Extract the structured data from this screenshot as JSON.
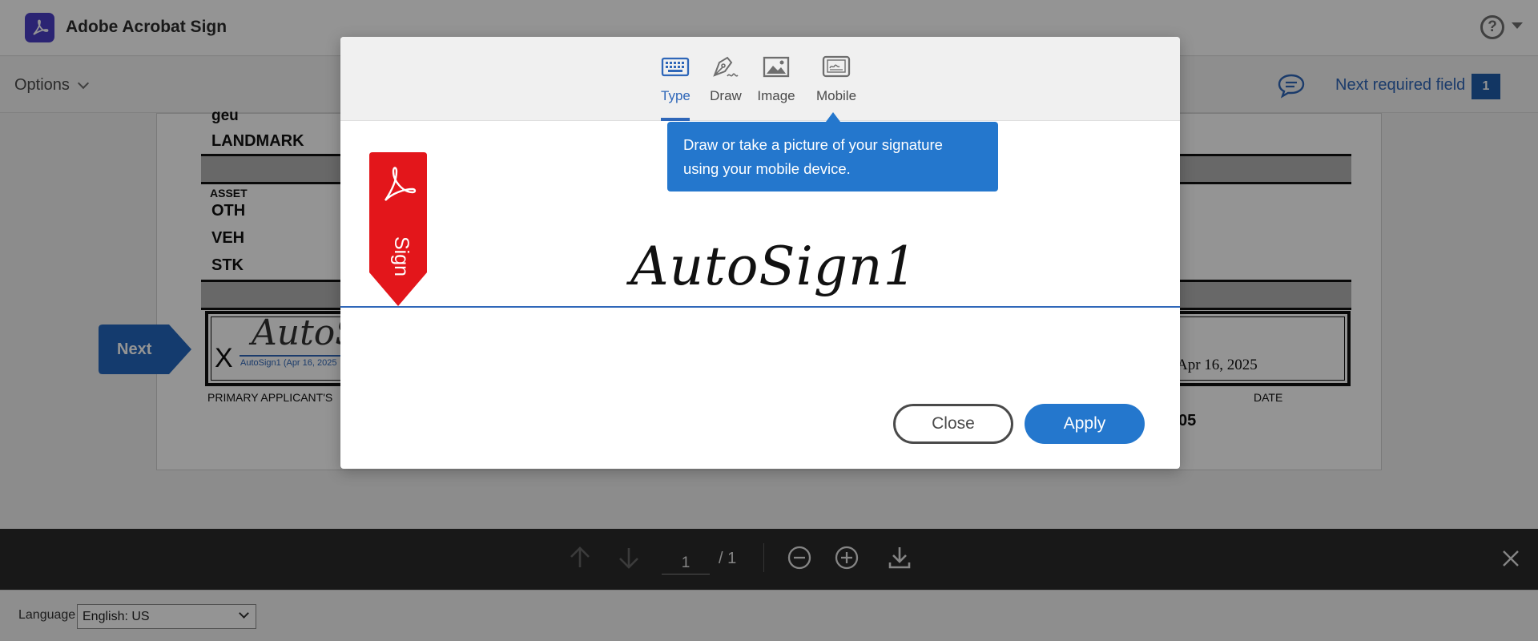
{
  "app": {
    "title": "Adobe Acrobat Sign",
    "logo_icon": "acrobat-logo-icon",
    "help_symbol": "?"
  },
  "subbar": {
    "options_label": "Options",
    "next_field_label": "Next required field",
    "next_field_count": "1"
  },
  "document": {
    "lines": {
      "partial_top": "geu",
      "landmark": "LANDMARK",
      "asset": "ASSET",
      "oth": "OTH",
      "veh": "VEH",
      "stk": "STK"
    },
    "signature_x": "X",
    "signature": "AutoSign1",
    "signature_sub": "AutoSign1 (Apr 16, 2025",
    "signature_date": "Apr 16, 2025",
    "applicant_label": "PRIMARY APPLICANT'S",
    "date_label": "DATE",
    "partial_year": "05",
    "next_tag": "Next"
  },
  "toolbar": {
    "page_current": "1",
    "page_total": "/ 1"
  },
  "footer": {
    "language_label": "Language",
    "language_value": "English: US"
  },
  "modal": {
    "tabs": [
      {
        "label": "Type",
        "icon": "keyboard-icon",
        "active": true
      },
      {
        "label": "Draw",
        "icon": "pen-icon",
        "active": false
      },
      {
        "label": "Image",
        "icon": "image-icon",
        "active": false
      },
      {
        "label": "Mobile",
        "icon": "mobile-icon",
        "active": false
      }
    ],
    "tooltip": "Draw or take a picture of your signature using your mobile device.",
    "sign_flag_label": "Sign",
    "signature_text": "AutoSign1",
    "close_label": "Close",
    "apply_label": "Apply"
  },
  "colors": {
    "accent": "#2477cd",
    "brand": "#4b3ec7",
    "sign_flag": "#e3161b"
  }
}
